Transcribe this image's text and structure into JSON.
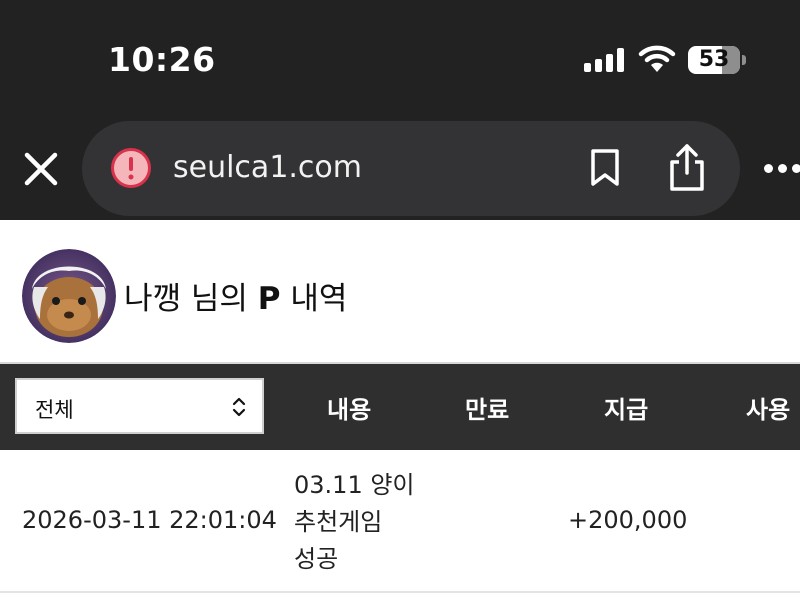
{
  "status_bar": {
    "time": "10:26",
    "battery": "53"
  },
  "browser": {
    "url": "seulca1.com"
  },
  "profile": {
    "name": "나깽",
    "suffix": " 님의 ",
    "points_label": "P",
    "tail": " 내역"
  },
  "table": {
    "filter_value": "전체",
    "columns": {
      "content": "내용",
      "expire": "만료",
      "paid": "지급",
      "used": "사용"
    },
    "rows": [
      {
        "date": "2026-03-11 22:01:04",
        "desc_line1": "03.11 양이",
        "desc_line2": "추천게임",
        "desc_line3": "성공",
        "paid": "+200,000"
      }
    ]
  },
  "colors": {
    "chrome_bg": "#222222",
    "urlbar_bg": "#333335",
    "header_bg": "#2f2f2f",
    "alert_red": "#f4b6bb"
  }
}
